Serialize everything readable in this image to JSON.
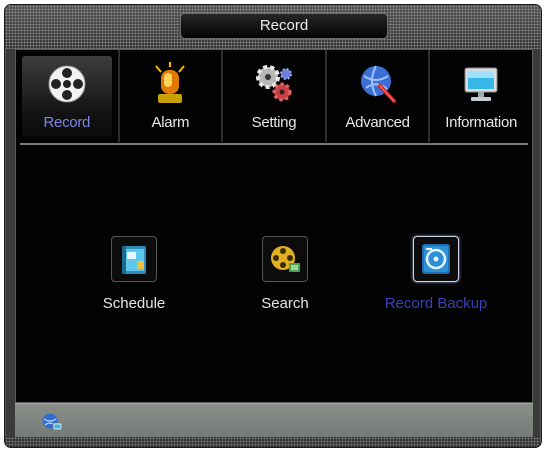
{
  "window": {
    "title": "Record"
  },
  "tabs": [
    {
      "id": "record",
      "label": "Record",
      "icon": "film-reel-icon",
      "active": true
    },
    {
      "id": "alarm",
      "label": "Alarm",
      "icon": "alarm-siren-icon",
      "active": false
    },
    {
      "id": "setting",
      "label": "Setting",
      "icon": "gears-icon",
      "active": false
    },
    {
      "id": "advanced",
      "label": "Advanced",
      "icon": "globe-wrench-icon",
      "active": false
    },
    {
      "id": "information",
      "label": "Information",
      "icon": "monitor-icon",
      "active": false
    }
  ],
  "items": [
    {
      "id": "schedule",
      "label": "Schedule",
      "icon": "schedule-book-icon",
      "selected": false
    },
    {
      "id": "search",
      "label": "Search",
      "icon": "film-search-icon",
      "selected": false
    },
    {
      "id": "record-backup",
      "label": "Record Backup",
      "icon": "backup-disk-icon",
      "selected": true
    }
  ],
  "statusbar": {
    "icon": "network-status-icon"
  },
  "colors": {
    "active_tab_label": "#7d86e8",
    "selected_item_label": "#3b3fb8",
    "panel_bg": "#020202"
  }
}
